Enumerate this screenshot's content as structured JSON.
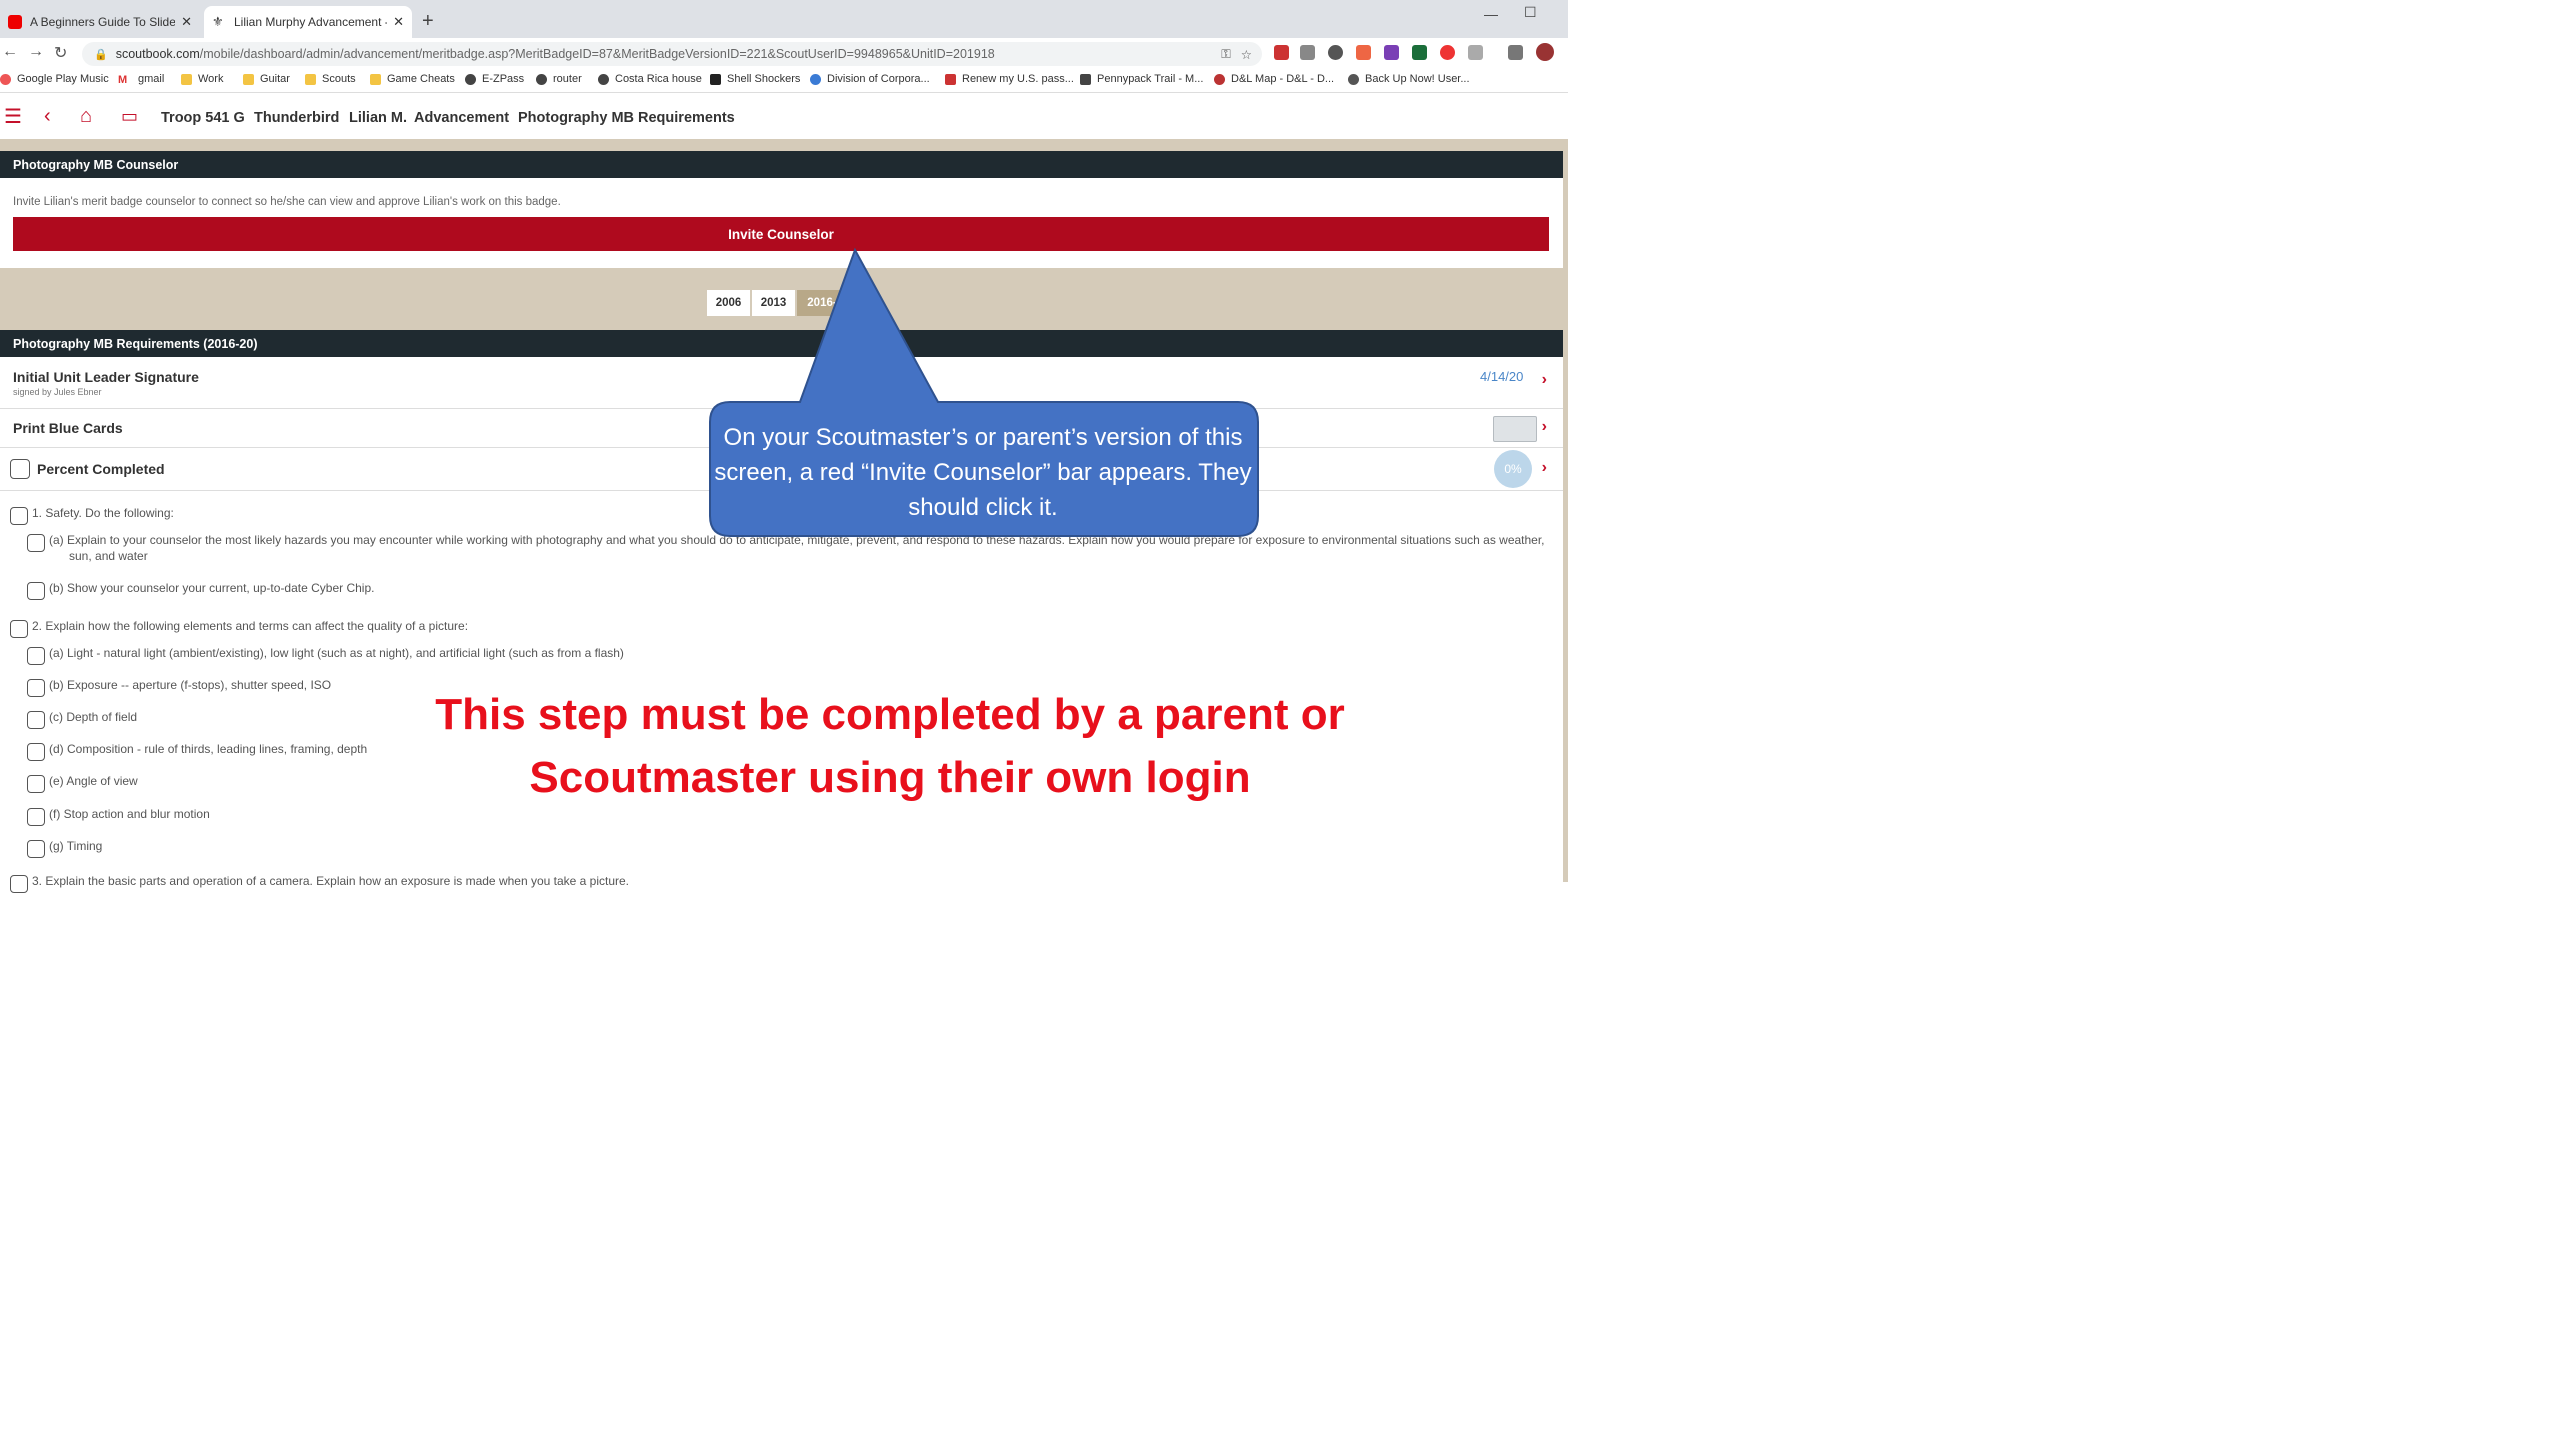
{
  "browser": {
    "tabs": [
      {
        "title": "A Beginners Guide To Slide Guitar",
        "active": false
      },
      {
        "title": "Lilian Murphy Advancement - Ph",
        "active": true
      }
    ],
    "new_tab": "+",
    "url_host": "scoutbook.com",
    "url_path": "/mobile/dashboard/admin/advancement/meritbadge.asp?MeritBadgeID=87&MeritBadgeVersionID=221&ScoutUserID=9948965&UnitID=201918",
    "bookmarks": [
      "Google Play Music",
      "gmail",
      "Work",
      "Guitar",
      "Scouts",
      "Game Cheats",
      "E-ZPass",
      "router",
      "Costa Rica house",
      "Shell Shockers",
      "Division of Corpora...",
      "Renew my U.S. pass...",
      "Pennypack Trail - M...",
      "D&L Map - D&L - D...",
      "Back Up Now! User..."
    ]
  },
  "app": {
    "breadcrumbs": [
      "Troop 541 G",
      "Thunderbird",
      "Lilian M.",
      "Advancement",
      "Photography MB Requirements"
    ],
    "counselor": {
      "header": "Photography MB Counselor",
      "text": "Invite Lilian's merit badge counselor to connect so he/she can view and approve Lilian's work on this badge.",
      "button": "Invite Counselor"
    },
    "versions": [
      "2006",
      "2013",
      "2016-"
    ],
    "requirements": {
      "header": "Photography MB Requirements (2016-20)",
      "signature_title": "Initial Unit Leader Signature",
      "signature_sub": "signed by Jules Ebner",
      "signature_date": "4/14/20",
      "print_title": "Print Blue Cards",
      "percent_title": "Percent Completed",
      "percent_value": "0%",
      "items": [
        {
          "text": "1.  Safety. Do the following:"
        },
        {
          "text": "(a)  Explain to your counselor the most likely hazards you may encounter while working with photography and what you should do to anticipate, mitigate, prevent, and respond to these hazards. Explain how you would prepare for exposure to environmental situations such as weather, sun, and water"
        },
        {
          "text": "(b)  Show your counselor your current, up-to-date Cyber Chip."
        },
        {
          "text": "2.  Explain how the following elements and terms can affect the quality of a picture:"
        },
        {
          "text": "(a)  Light - natural light (ambient/existing), low light (such as at night), and artificial light (such as from a flash)"
        },
        {
          "text": "(b)  Exposure -- aperture (f-stops), shutter speed, ISO"
        },
        {
          "text": "(c)  Depth of field"
        },
        {
          "text": "(d)  Composition - rule of thirds, leading lines, framing, depth"
        },
        {
          "text": "(e)  Angle of view"
        },
        {
          "text": "(f)  Stop action and blur motion"
        },
        {
          "text": "(g)  Timing"
        },
        {
          "text": "3.  Explain the basic parts and operation of a camera. Explain how an exposure is made when you take a picture."
        }
      ]
    }
  },
  "callout": {
    "text": "On your Scoutmaster’s or parent’s version of this screen, a red “Invite Counselor” bar appears.  They should click it.",
    "fill": "#4472c4"
  },
  "overlay": {
    "text": "This step must be completed by a parent or Scoutmaster using their own login",
    "color": "#e8101c"
  }
}
